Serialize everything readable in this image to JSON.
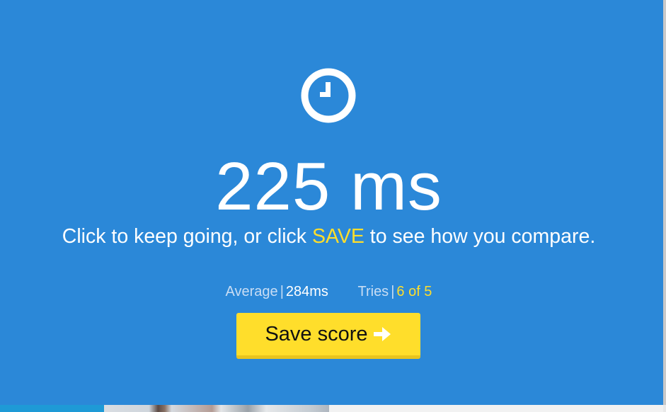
{
  "result": {
    "value": "225",
    "unit": "ms"
  },
  "hint": {
    "before": "Click to keep going, or click ",
    "highlight": "SAVE",
    "after": " to see how you compare."
  },
  "stats": {
    "average_label": "Average",
    "average_value": "284ms",
    "tries_label": "Tries",
    "tries_value": "6 of 5",
    "separator": "|"
  },
  "save_button": {
    "label": "Save score"
  },
  "icons": {
    "timer": "clock-icon",
    "save_arrow": "arrow-right-icon"
  },
  "colors": {
    "background": "#2b88d8",
    "accent": "#ffde2b",
    "text": "#ffffff",
    "muted": "#c8ddf4"
  }
}
